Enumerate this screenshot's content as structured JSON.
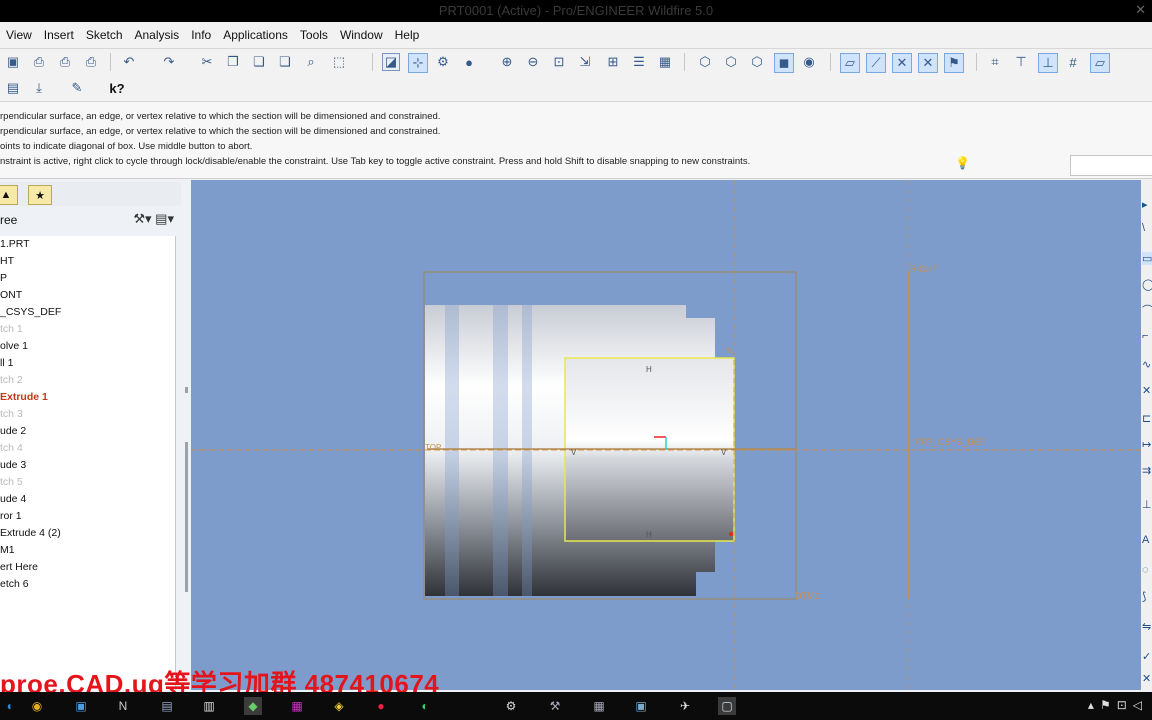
{
  "window": {
    "title": "PRT0001 (Active) - Pro/ENGINEER Wildfire 5.0",
    "close_glyph": "✕"
  },
  "menu": [
    "View",
    "Insert",
    "Sketch",
    "Analysis",
    "Info",
    "Applications",
    "Tools",
    "Window",
    "Help"
  ],
  "messages": [
    "rpendicular surface, an edge, or vertex relative to which the section will be dimensioned and constrained.",
    "rpendicular surface, an edge, or vertex relative to which the section will be dimensioned and constrained.",
    "oints to indicate diagonal of box. Use middle button to abort.",
    "nstraint is active, right click to cycle through lock/disable/enable the constraint. Use Tab key to toggle active constraint. Press and hold Shift to disable snapping to new constraints."
  ],
  "navigator": {
    "header": "ree"
  },
  "tree": [
    {
      "label": "1.PRT",
      "state": "normal"
    },
    {
      "label": "HT",
      "state": "normal"
    },
    {
      "label": "P",
      "state": "normal"
    },
    {
      "label": "ONT",
      "state": "normal"
    },
    {
      "label": "_CSYS_DEF",
      "state": "normal"
    },
    {
      "label": "tch 1",
      "state": "dim"
    },
    {
      "label": "olve 1",
      "state": "normal"
    },
    {
      "label": "ll 1",
      "state": "normal"
    },
    {
      "label": "tch 2",
      "state": "dim"
    },
    {
      "label": "Extrude 1",
      "state": "active"
    },
    {
      "label": "tch 3",
      "state": "dim"
    },
    {
      "label": "ude 2",
      "state": "normal"
    },
    {
      "label": "tch 4",
      "state": "dim"
    },
    {
      "label": "ude 3",
      "state": "normal"
    },
    {
      "label": "tch 5",
      "state": "dim"
    },
    {
      "label": "ude 4",
      "state": "normal"
    },
    {
      "label": "ror 1",
      "state": "normal"
    },
    {
      "label": "Extrude 4 (2)",
      "state": "normal"
    },
    {
      "label": "M1",
      "state": "normal"
    },
    {
      "label": "ert Here",
      "state": "normal"
    },
    {
      "label": "etch 6",
      "state": "normal"
    }
  ],
  "canvas_labels": {
    "right": "RIGHT",
    "csys": "PRT_CSYS_DEF",
    "dtm": "DTM1",
    "top": "TOP",
    "h_marker": "H",
    "v_marker": "V"
  },
  "watermark": "proe.CAD.ug等学习加群  487410674",
  "colors": {
    "canvas": "#7d9ccb",
    "sketch_box": "#e8e84a",
    "datum": "#d88a3a",
    "watermark": "#e5141b"
  }
}
